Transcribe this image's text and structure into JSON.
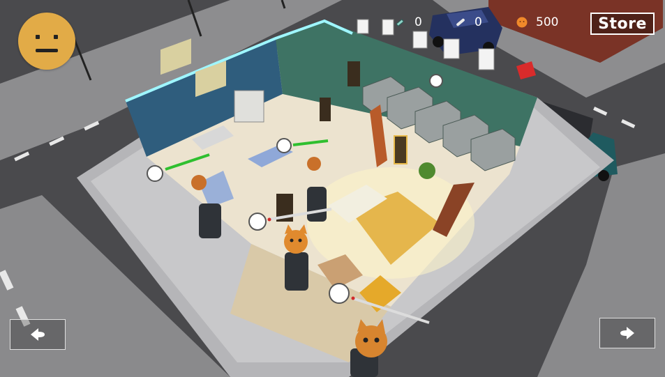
{
  "hud": {
    "mood_icon": "neutral-face-icon",
    "counters": [
      {
        "name": "syringe-count",
        "icon": "syringe-icon",
        "value": "0"
      },
      {
        "name": "medicine-count",
        "icon": "pill-icon",
        "value": "0"
      },
      {
        "name": "coin-count",
        "icon": "cat-coin-icon",
        "value": "500"
      }
    ],
    "store_label": "Store",
    "prev_icon": "left-arrow-icon",
    "next_icon": "right-arrow-icon"
  },
  "colors": {
    "mood_face": "#e2ab47",
    "progress_green": "#2fbf2f",
    "progress_red": "#d12a2a",
    "coin": "#f0892a"
  }
}
